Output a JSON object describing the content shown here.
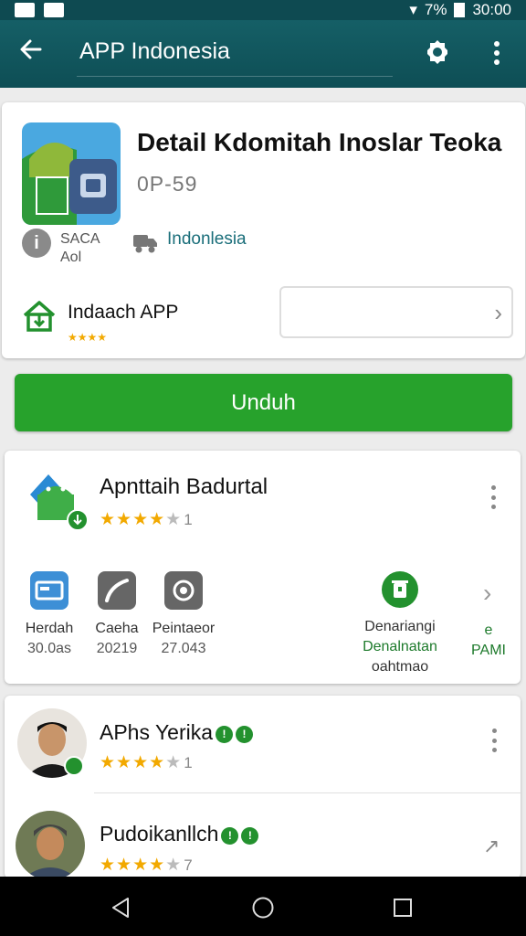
{
  "status_bar": {
    "time": "30:00",
    "battery_text": "7%"
  },
  "app_bar": {
    "title": "APP Indonesia",
    "back_icon": "arrow-left-icon",
    "settings_icon": "gear-icon",
    "more_icon": "more-vert-icon",
    "background": "#135a61"
  },
  "app_card": {
    "title": "Detail Kdomitah Inoslar Teoka",
    "version": "0P-59",
    "info_line1": "SACA",
    "info_line2": "Aol",
    "region": "Indonlesia",
    "install_label": "Indaach APP",
    "install_rating_stars": 4
  },
  "download_button": {
    "label": "Unduh",
    "color": "#27a22c"
  },
  "app_item": {
    "title": "Apnttaih Badurtal",
    "rating_stars": 4,
    "rating_count": "1",
    "features": [
      {
        "label": "Herdah",
        "value": "30.0as"
      },
      {
        "label": "Caeha",
        "value": "20219"
      },
      {
        "label": "Peintaeor",
        "value": "27.043"
      }
    ],
    "feature_right": {
      "line1": "Denariangi",
      "line2": "Denalnatan",
      "line3": "oahtmao"
    },
    "feature_far_right": {
      "line1": "e",
      "line2": "PAMI"
    }
  },
  "users": [
    {
      "name": "APhs Yerika",
      "rating_stars": 4,
      "rating_count": "1"
    },
    {
      "name": "Pudoikanllch",
      "rating_stars": 3.5,
      "rating_count": "7"
    }
  ],
  "accent_color": "#23912e",
  "star_color": "#f2a900"
}
